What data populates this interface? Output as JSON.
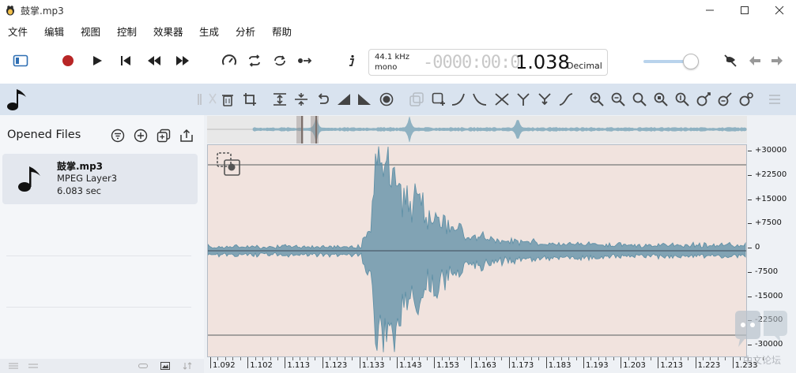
{
  "window": {
    "title": "鼓掌.mp3"
  },
  "menu": {
    "items": [
      "文件",
      "编辑",
      "视图",
      "控制",
      "效果器",
      "生成",
      "分析",
      "帮助"
    ]
  },
  "toolbar": {
    "sample_rate": "44.1 kHz",
    "channels": "mono",
    "time_placeholder": "-0000:00:0",
    "time_value": "1.038",
    "time_format": "Decimal",
    "volume_fraction": 0.85
  },
  "sidebar": {
    "title": "Opened Files",
    "file": {
      "name": "鼓掌.mp3",
      "format": "MPEG Layer3",
      "duration": "6.083 sec"
    }
  },
  "axis": {
    "y_ticks": [
      "+30000",
      "+22500",
      "+15000",
      "+7500",
      "0",
      "-7500",
      "-15000",
      "-22500",
      "-30000"
    ],
    "x_ticks": [
      "1.092",
      "1.102",
      "1.113",
      "1.123",
      "1.133",
      "1.143",
      "1.153",
      "1.163",
      "1.173",
      "1.183",
      "1.193",
      "1.203",
      "1.213",
      "1.223",
      "1.233"
    ]
  },
  "watermark": "中文论坛",
  "colors": {
    "wave": "#5b8ea5",
    "wave_bg": "#f1e3de",
    "panel": "#d9e3ef",
    "accent": "#b82626"
  }
}
